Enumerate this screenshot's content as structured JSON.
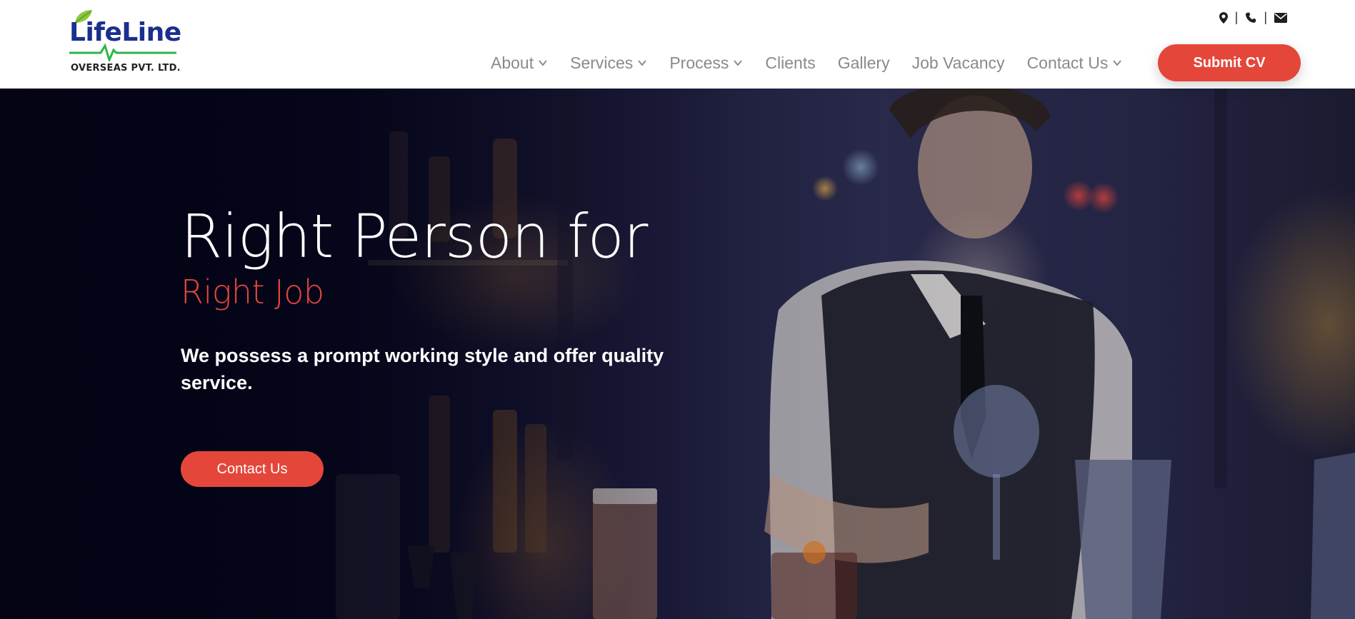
{
  "brand": {
    "logo_text": "LifeLine",
    "logo_subtext": "OVERSEAS PVT. LTD.",
    "colors": {
      "primary_blue": "#1c2f8c",
      "pulse_green": "#2db54a",
      "accent_red": "#e5463a"
    }
  },
  "top_bar": {
    "icons": [
      "map-marker-icon",
      "phone-icon",
      "envelope-icon"
    ],
    "separator": "|"
  },
  "nav": {
    "items": [
      {
        "label": "About",
        "has_dropdown": true
      },
      {
        "label": "Services",
        "has_dropdown": true
      },
      {
        "label": "Process",
        "has_dropdown": true
      },
      {
        "label": "Clients",
        "has_dropdown": false
      },
      {
        "label": "Gallery",
        "has_dropdown": false
      },
      {
        "label": "Job Vacancy",
        "has_dropdown": false
      },
      {
        "label": "Contact Us",
        "has_dropdown": true
      }
    ],
    "cta_label": "Submit CV"
  },
  "hero": {
    "title": "Right Person for",
    "subtitle": "Right Job",
    "description": "We possess a prompt working style and offer quality service.",
    "button_label": "Contact Us"
  }
}
